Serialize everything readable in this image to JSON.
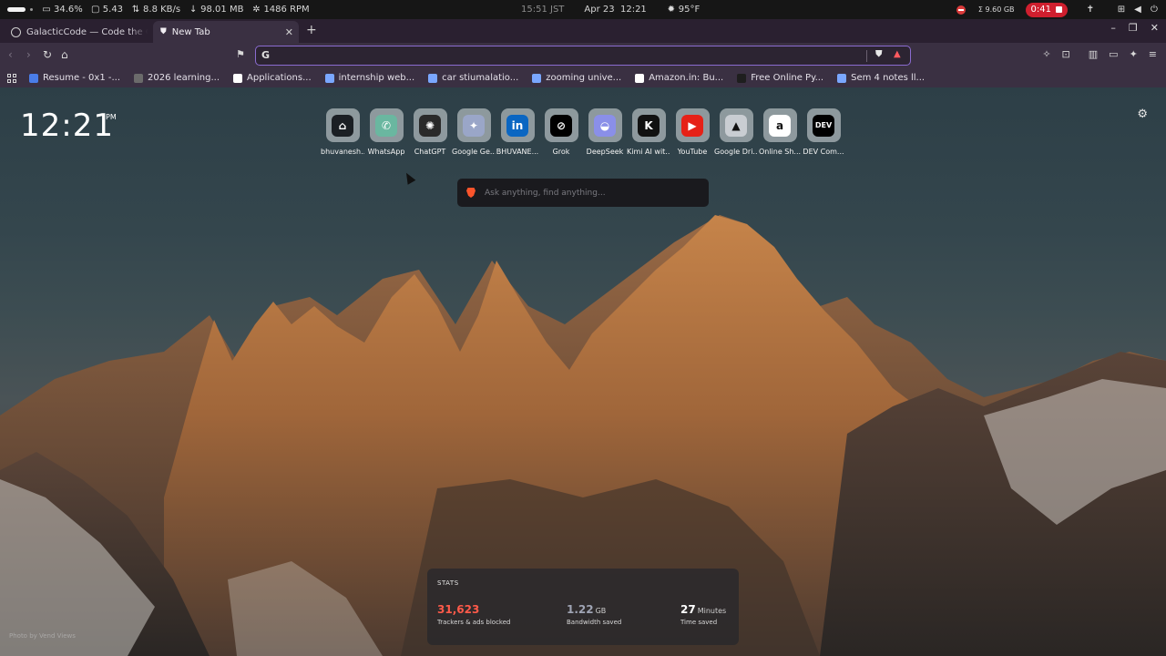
{
  "system_bar": {
    "cpu": "34.6%",
    "load": "5.43",
    "net": "8.8 KB/s",
    "memory": "98.01 MB",
    "fan": "1486 RPM",
    "time_jst": "15:51 JST",
    "date": "Apr 23",
    "time": "12:21",
    "weather": "95°F",
    "disk": "Σ 9.60 GB",
    "recording": "0:41"
  },
  "tabs": [
    {
      "title": "GalacticCode — Code the Co"
    },
    {
      "title": "New Tab"
    }
  ],
  "omnibox": {
    "value": "",
    "placeholder": ""
  },
  "bookmarks": [
    {
      "label": "Resume - 0x1 -...",
      "icon": "doc-icon",
      "color": "#4a7de8"
    },
    {
      "label": "2026 learning...",
      "icon": "openai-icon",
      "color": "#6b6b6b"
    },
    {
      "label": "Applications...",
      "icon": "google-icon",
      "color": "#ffffff"
    },
    {
      "label": "internship web...",
      "icon": "gemini-icon",
      "color": "#7aa7ff"
    },
    {
      "label": "car stiumalatio...",
      "icon": "gemini-icon",
      "color": "#7aa7ff"
    },
    {
      "label": "zooming unive...",
      "icon": "gemini-icon",
      "color": "#7aa7ff"
    },
    {
      "label": "Amazon.in: Bu...",
      "icon": "amazon-icon",
      "color": "#ffffff"
    },
    {
      "label": "Free Online Py...",
      "icon": "python-icon",
      "color": "#1e1e1e"
    },
    {
      "label": "Sem 4 notes ll...",
      "icon": "gemini-icon",
      "color": "#7aa7ff"
    }
  ],
  "clock": {
    "time": "12:21",
    "ampm": "PM"
  },
  "top_sites": [
    {
      "label": "bhuvanesh...",
      "icon": "github-icon",
      "bg": "#1b1f24",
      "glyph": "⌂"
    },
    {
      "label": "WhatsApp",
      "icon": "whatsapp-icon",
      "bg": "#6ab7a0",
      "glyph": "✆"
    },
    {
      "label": "ChatGPT",
      "icon": "chatgpt-icon",
      "bg": "#2a2a2a",
      "glyph": "✺"
    },
    {
      "label": "Google Ge...",
      "icon": "gemini-icon",
      "bg": "#9aa6c8",
      "glyph": "✦"
    },
    {
      "label": "BHUVANE...",
      "icon": "linkedin-icon",
      "bg": "#0a66c2",
      "glyph": "in"
    },
    {
      "label": "Grok",
      "icon": "grok-icon",
      "bg": "#000000",
      "glyph": "⊘"
    },
    {
      "label": "DeepSeek",
      "icon": "deepseek-icon",
      "bg": "#8a8fe8",
      "glyph": "◒"
    },
    {
      "label": "Kimi AI wit...",
      "icon": "kimi-icon",
      "bg": "#111111",
      "glyph": "K"
    },
    {
      "label": "YouTube",
      "icon": "youtube-icon",
      "bg": "#e62117",
      "glyph": "▶"
    },
    {
      "label": "Google Dri...",
      "icon": "google-drive-icon",
      "bg": "#c9cdd2",
      "glyph": "▲"
    },
    {
      "label": "Online Sh...",
      "icon": "amazon-icon",
      "bg": "#ffffff",
      "glyph": "a"
    },
    {
      "label": "DEV Com...",
      "icon": "dev-icon",
      "bg": "#000000",
      "glyph": "DEV"
    }
  ],
  "ask": {
    "placeholder": "Ask anything, find anything..."
  },
  "stats": {
    "title": "STATS",
    "trackers": {
      "value": "31,623",
      "unit": "",
      "caption": "Trackers & ads blocked",
      "color": "#ff5a4a"
    },
    "bandwidth": {
      "value": "1.22",
      "unit": "GB",
      "caption": "Bandwidth saved",
      "color": "#9fa4b4"
    },
    "time": {
      "value": "27",
      "unit": "Minutes",
      "caption": "Time saved",
      "color": "#ffffff"
    }
  },
  "photo_credit": "Photo by Vend Views"
}
